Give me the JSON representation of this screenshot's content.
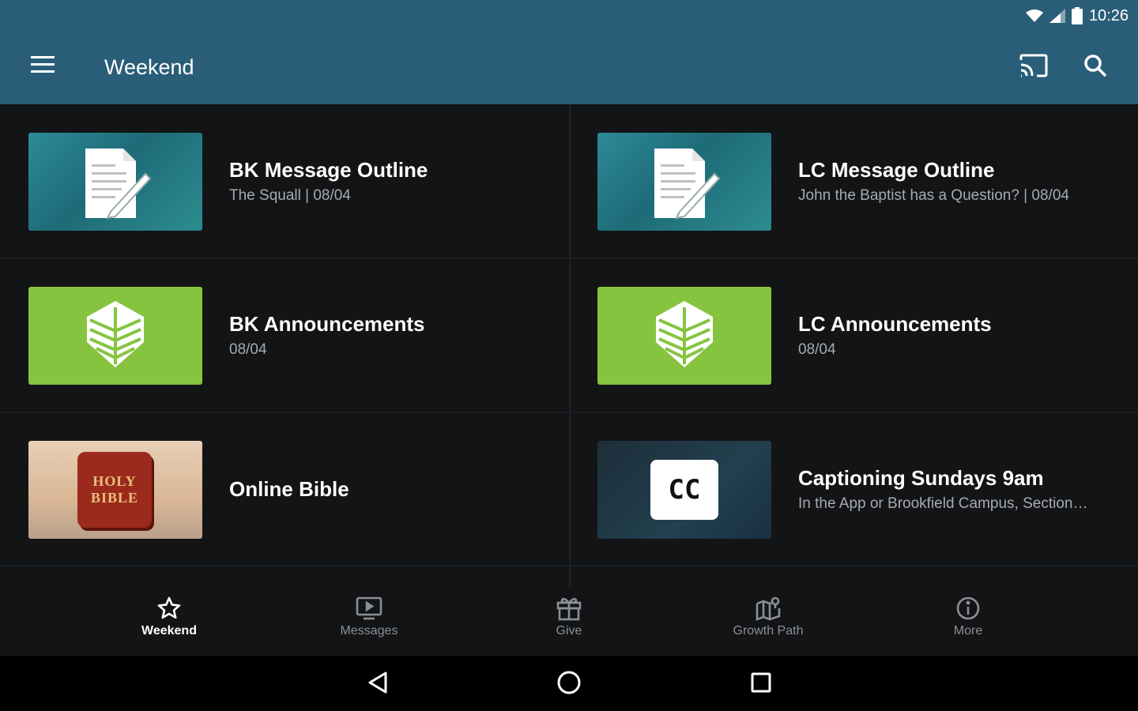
{
  "status_bar": {
    "time": "10:26"
  },
  "app_bar": {
    "title": "Weekend"
  },
  "cards": [
    {
      "title": "BK Message Outline",
      "subtitle": "The Squall | 08/04",
      "thumbnail": "document-icon"
    },
    {
      "title": "LC Message Outline",
      "subtitle": "John the Baptist has a Question? | 08/04",
      "thumbnail": "document-icon"
    },
    {
      "title": "BK Announcements",
      "subtitle": "08/04",
      "thumbnail": "leaf-logo-icon"
    },
    {
      "title": "LC Announcements",
      "subtitle": "08/04",
      "thumbnail": "leaf-logo-icon"
    },
    {
      "title": "Online Bible",
      "subtitle": "",
      "thumbnail": "holy-bible-image",
      "thumb_text": [
        "HOLY",
        "BIBLE"
      ]
    },
    {
      "title": "Captioning Sundays 9am",
      "subtitle": "In the App or Brookfield Campus, Section…",
      "thumbnail": "cc-icon",
      "thumb_text": "CC"
    }
  ],
  "bottom_nav": [
    {
      "label": "Weekend",
      "icon": "star-icon",
      "active": true
    },
    {
      "label": "Messages",
      "icon": "video-icon",
      "active": false
    },
    {
      "label": "Give",
      "icon": "gift-icon",
      "active": false
    },
    {
      "label": "Growth Path",
      "icon": "map-pin-icon",
      "active": false
    },
    {
      "label": "More",
      "icon": "info-icon",
      "active": false
    }
  ],
  "colors": {
    "app_bar": "#2a5e78",
    "background": "#121416",
    "accent_green": "#86c440",
    "active_nav": "#ffffff",
    "inactive_nav": "#8c9094"
  }
}
